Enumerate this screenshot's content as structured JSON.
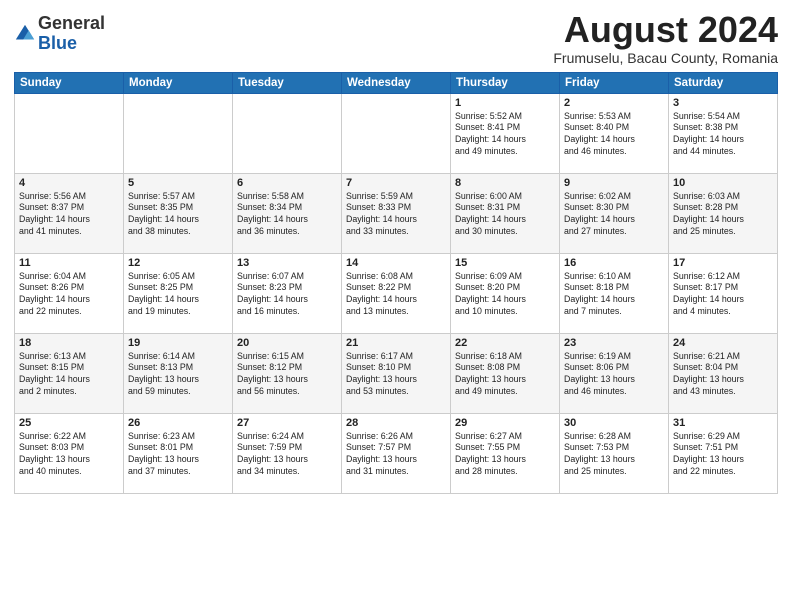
{
  "logo": {
    "general": "General",
    "blue": "Blue"
  },
  "title": "August 2024",
  "subtitle": "Frumuselu, Bacau County, Romania",
  "weekdays": [
    "Sunday",
    "Monday",
    "Tuesday",
    "Wednesday",
    "Thursday",
    "Friday",
    "Saturday"
  ],
  "weeks": [
    [
      {
        "day": "",
        "content": ""
      },
      {
        "day": "",
        "content": ""
      },
      {
        "day": "",
        "content": ""
      },
      {
        "day": "",
        "content": ""
      },
      {
        "day": "1",
        "content": "Sunrise: 5:52 AM\nSunset: 8:41 PM\nDaylight: 14 hours\nand 49 minutes."
      },
      {
        "day": "2",
        "content": "Sunrise: 5:53 AM\nSunset: 8:40 PM\nDaylight: 14 hours\nand 46 minutes."
      },
      {
        "day": "3",
        "content": "Sunrise: 5:54 AM\nSunset: 8:38 PM\nDaylight: 14 hours\nand 44 minutes."
      }
    ],
    [
      {
        "day": "4",
        "content": "Sunrise: 5:56 AM\nSunset: 8:37 PM\nDaylight: 14 hours\nand 41 minutes."
      },
      {
        "day": "5",
        "content": "Sunrise: 5:57 AM\nSunset: 8:35 PM\nDaylight: 14 hours\nand 38 minutes."
      },
      {
        "day": "6",
        "content": "Sunrise: 5:58 AM\nSunset: 8:34 PM\nDaylight: 14 hours\nand 36 minutes."
      },
      {
        "day": "7",
        "content": "Sunrise: 5:59 AM\nSunset: 8:33 PM\nDaylight: 14 hours\nand 33 minutes."
      },
      {
        "day": "8",
        "content": "Sunrise: 6:00 AM\nSunset: 8:31 PM\nDaylight: 14 hours\nand 30 minutes."
      },
      {
        "day": "9",
        "content": "Sunrise: 6:02 AM\nSunset: 8:30 PM\nDaylight: 14 hours\nand 27 minutes."
      },
      {
        "day": "10",
        "content": "Sunrise: 6:03 AM\nSunset: 8:28 PM\nDaylight: 14 hours\nand 25 minutes."
      }
    ],
    [
      {
        "day": "11",
        "content": "Sunrise: 6:04 AM\nSunset: 8:26 PM\nDaylight: 14 hours\nand 22 minutes."
      },
      {
        "day": "12",
        "content": "Sunrise: 6:05 AM\nSunset: 8:25 PM\nDaylight: 14 hours\nand 19 minutes."
      },
      {
        "day": "13",
        "content": "Sunrise: 6:07 AM\nSunset: 8:23 PM\nDaylight: 14 hours\nand 16 minutes."
      },
      {
        "day": "14",
        "content": "Sunrise: 6:08 AM\nSunset: 8:22 PM\nDaylight: 14 hours\nand 13 minutes."
      },
      {
        "day": "15",
        "content": "Sunrise: 6:09 AM\nSunset: 8:20 PM\nDaylight: 14 hours\nand 10 minutes."
      },
      {
        "day": "16",
        "content": "Sunrise: 6:10 AM\nSunset: 8:18 PM\nDaylight: 14 hours\nand 7 minutes."
      },
      {
        "day": "17",
        "content": "Sunrise: 6:12 AM\nSunset: 8:17 PM\nDaylight: 14 hours\nand 4 minutes."
      }
    ],
    [
      {
        "day": "18",
        "content": "Sunrise: 6:13 AM\nSunset: 8:15 PM\nDaylight: 14 hours\nand 2 minutes."
      },
      {
        "day": "19",
        "content": "Sunrise: 6:14 AM\nSunset: 8:13 PM\nDaylight: 13 hours\nand 59 minutes."
      },
      {
        "day": "20",
        "content": "Sunrise: 6:15 AM\nSunset: 8:12 PM\nDaylight: 13 hours\nand 56 minutes."
      },
      {
        "day": "21",
        "content": "Sunrise: 6:17 AM\nSunset: 8:10 PM\nDaylight: 13 hours\nand 53 minutes."
      },
      {
        "day": "22",
        "content": "Sunrise: 6:18 AM\nSunset: 8:08 PM\nDaylight: 13 hours\nand 49 minutes."
      },
      {
        "day": "23",
        "content": "Sunrise: 6:19 AM\nSunset: 8:06 PM\nDaylight: 13 hours\nand 46 minutes."
      },
      {
        "day": "24",
        "content": "Sunrise: 6:21 AM\nSunset: 8:04 PM\nDaylight: 13 hours\nand 43 minutes."
      }
    ],
    [
      {
        "day": "25",
        "content": "Sunrise: 6:22 AM\nSunset: 8:03 PM\nDaylight: 13 hours\nand 40 minutes."
      },
      {
        "day": "26",
        "content": "Sunrise: 6:23 AM\nSunset: 8:01 PM\nDaylight: 13 hours\nand 37 minutes."
      },
      {
        "day": "27",
        "content": "Sunrise: 6:24 AM\nSunset: 7:59 PM\nDaylight: 13 hours\nand 34 minutes."
      },
      {
        "day": "28",
        "content": "Sunrise: 6:26 AM\nSunset: 7:57 PM\nDaylight: 13 hours\nand 31 minutes."
      },
      {
        "day": "29",
        "content": "Sunrise: 6:27 AM\nSunset: 7:55 PM\nDaylight: 13 hours\nand 28 minutes."
      },
      {
        "day": "30",
        "content": "Sunrise: 6:28 AM\nSunset: 7:53 PM\nDaylight: 13 hours\nand 25 minutes."
      },
      {
        "day": "31",
        "content": "Sunrise: 6:29 AM\nSunset: 7:51 PM\nDaylight: 13 hours\nand 22 minutes."
      }
    ]
  ]
}
